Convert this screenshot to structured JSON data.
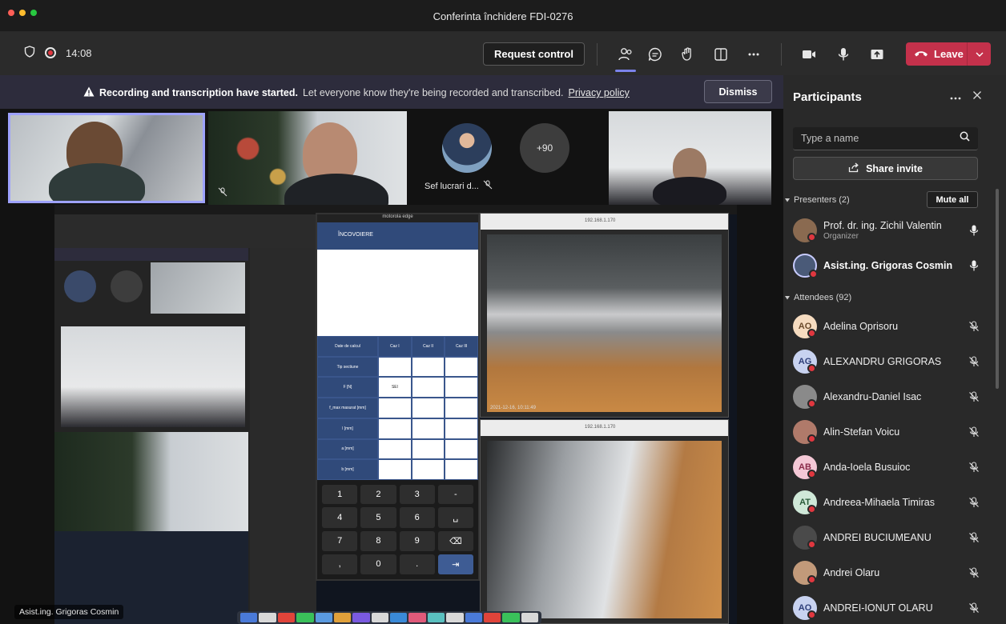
{
  "window": {
    "title": "Conferinta închidere FDI-0276",
    "traffic_colors": [
      "#ff5f57",
      "#febc2e",
      "#28c840"
    ]
  },
  "toolbar": {
    "time": "14:08",
    "request_control_label": "Request control",
    "leave_label": "Leave",
    "icons": [
      "shield-icon",
      "record-icon",
      "people-icon",
      "chat-icon",
      "raise-hand-icon",
      "room-icon",
      "more-icon",
      "camera-icon",
      "mic-icon",
      "share-screen-icon"
    ]
  },
  "banner": {
    "bold_text": "Recording and transcription have started.",
    "text": "Let everyone know they're being recorded and transcribed.",
    "link": "Privacy policy",
    "dismiss_label": "Dismiss"
  },
  "stage": {
    "tiles": [
      {
        "id": "tile-1"
      },
      {
        "id": "tile-2"
      },
      {
        "id": "tile-sef",
        "label": "Sef lucrari d..."
      },
      {
        "id": "tile-more",
        "label": "+90"
      },
      {
        "id": "tile-4"
      }
    ],
    "presenter_label": "Asist.ing. Grigoras Cosmin",
    "shared": {
      "phone_title": "motorola edge",
      "phone_header": "ÎNCOVOIERE",
      "table_headers": [
        "Date de calcul",
        "Caz I",
        "Caz II",
        "Caz III"
      ],
      "table_rows": [
        "Tip sectiune",
        "F [N]",
        "f_max masurat [mm]",
        "l [mm]",
        "a [mm]",
        "b [mm]"
      ],
      "cell_value": "SEl",
      "keypad": [
        "1",
        "2",
        "3",
        "-",
        "4",
        "5",
        "6",
        "␣",
        "7",
        "8",
        "9",
        "⌫",
        ",",
        "0",
        ".",
        "⇥"
      ],
      "cam_address": "192.168.1.170",
      "cam_timestamp": "2021-12-16, 10:11:49"
    }
  },
  "panel": {
    "title": "Participants",
    "search_placeholder": "Type a name",
    "share_invite_label": "Share invite",
    "presenters_label": "Presenters (2)",
    "mute_all_label": "Mute all",
    "attendees_label": "Attendees (92)",
    "presenters": [
      {
        "name": "Prof. dr. ing. Zichil Valentin",
        "role": "Organizer",
        "initials": "",
        "color": "#8a6a50",
        "bold": false
      },
      {
        "name": "Asist.ing. Grigoras Cosmin",
        "role": "",
        "initials": "",
        "color": "#4a5a78",
        "bold": true
      }
    ],
    "attendees": [
      {
        "name": "Adelina Oprisoru",
        "initials": "AO",
        "color": "#f6dcc0",
        "fg": "#6b4a2a"
      },
      {
        "name": "ALEXANDRU GRIGORAS",
        "initials": "AG",
        "color": "#c8d2f0",
        "fg": "#2f3f7a"
      },
      {
        "name": "Alexandru-Daniel Isac",
        "initials": "",
        "color": "#8a8a8a",
        "fg": "#fff"
      },
      {
        "name": "Alin-Stefan Voicu",
        "initials": "",
        "color": "#b07a6a",
        "fg": "#fff"
      },
      {
        "name": "Anda-Ioela Busuioc",
        "initials": "AB",
        "color": "#f4c8d6",
        "fg": "#8a2a4a"
      },
      {
        "name": "Andreea-Mihaela Timiras",
        "initials": "AT",
        "color": "#cfe8d8",
        "fg": "#2a5a3a"
      },
      {
        "name": "ANDREI BUCIUMEANU",
        "initials": "",
        "color": "#4a4a4a",
        "fg": "#fff"
      },
      {
        "name": "Andrei Olaru",
        "initials": "",
        "color": "#c29a7a",
        "fg": "#fff"
      },
      {
        "name": "ANDREI-IONUT OLARU",
        "initials": "AO",
        "color": "#c8d2f0",
        "fg": "#2f3f7a"
      }
    ]
  }
}
